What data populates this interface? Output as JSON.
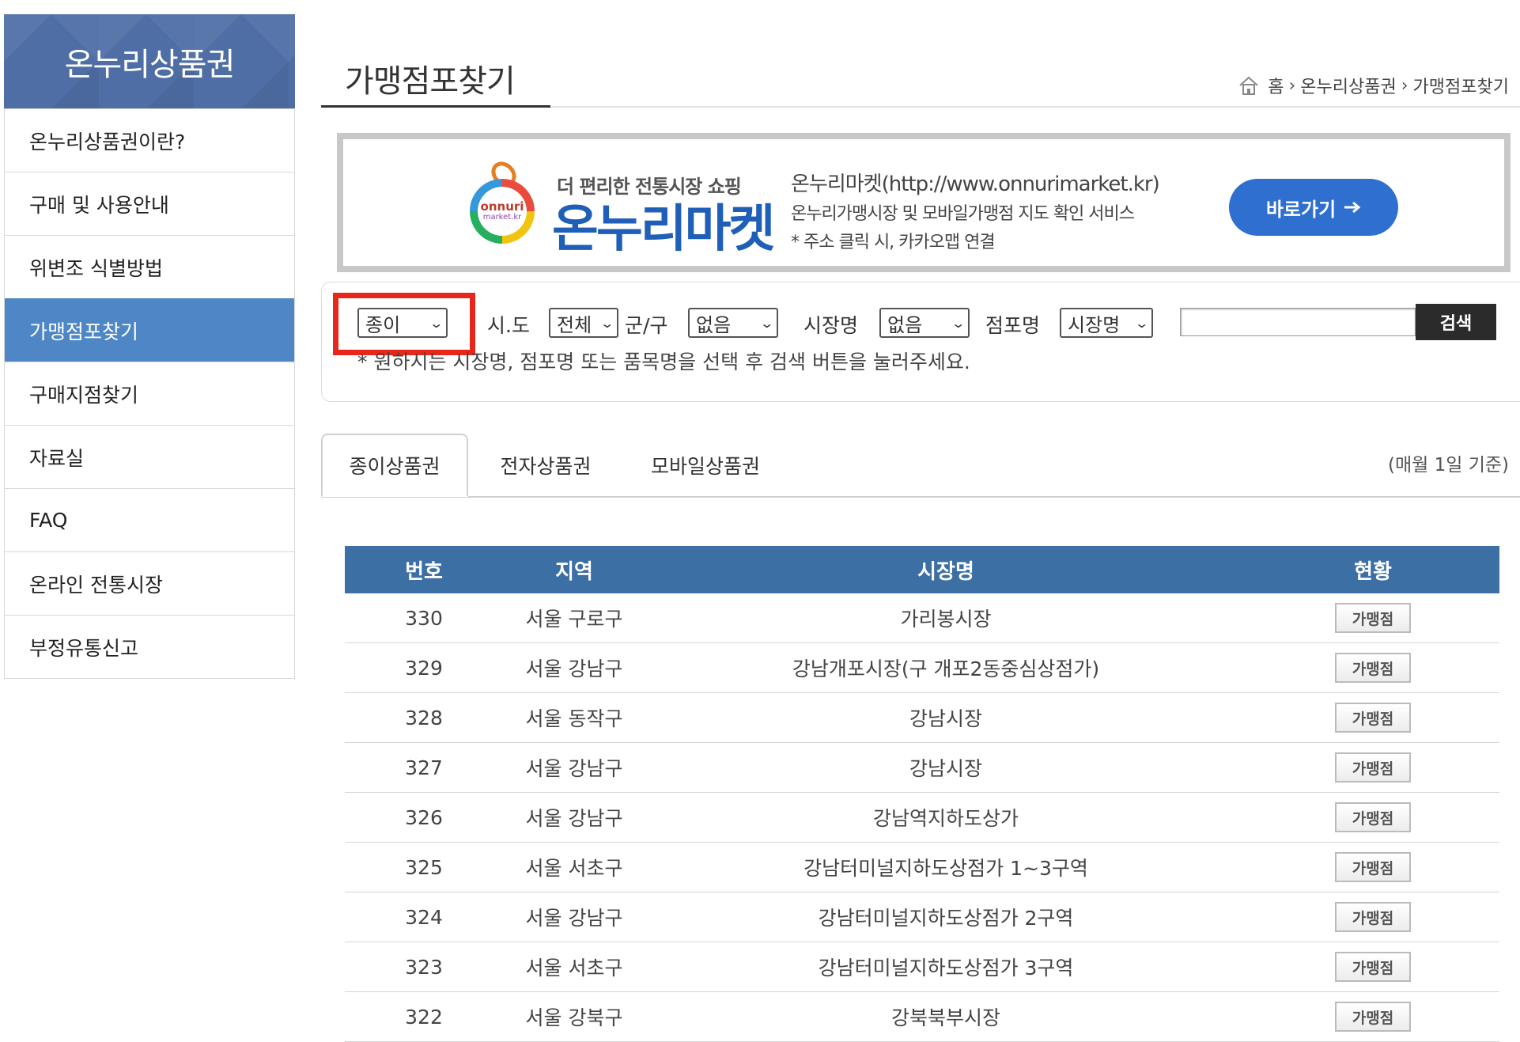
{
  "sidebar": {
    "title": "온누리상품권",
    "items": [
      {
        "label": "온누리상품권이란?"
      },
      {
        "label": "구매 및 사용안내"
      },
      {
        "label": "위변조 식별방법"
      },
      {
        "label": "가맹점포찾기"
      },
      {
        "label": "구매지점찾기"
      },
      {
        "label": "자료실"
      },
      {
        "label": "FAQ"
      },
      {
        "label": "온라인 전통시장"
      },
      {
        "label": "부정유통신고"
      }
    ],
    "active_index": 3
  },
  "header": {
    "page_title": "가맹점포찾기",
    "breadcrumb": [
      "홈",
      "온누리상품권",
      "가맹점포찾기"
    ]
  },
  "banner": {
    "tagline": "더 편리한 전통시장 쇼핑",
    "brand": "온누리마켓",
    "logo_text_1": "onnuri",
    "logo_text_2": "market.kr",
    "info_line_1": "온누리마켓(http://www.onnurimarket.kr)",
    "info_line_2": "온누리가맹시장 및 모바일가맹점 지도 확인 서비스",
    "info_line_3": "* 주소 클릭 시, 카카오맵 연결",
    "button_label": "바로가기"
  },
  "search": {
    "type_select": "종이",
    "sido_label": "시.도",
    "sido_select": "전체",
    "gungu_label": "군/구",
    "gungu_select": "없음",
    "market_label": "시장명",
    "market_select": "없음",
    "store_label": "점포명",
    "store_select": "시장명",
    "input_value": "",
    "button_label": "검색",
    "help_text": "* 원하시는 시장명, 점포명 또는 품목명을 선택 후 검색 버튼을 눌러주세요."
  },
  "tabs": [
    {
      "label": "종이상품권",
      "active": true
    },
    {
      "label": "전자상품권",
      "active": false
    },
    {
      "label": "모바일상품권",
      "active": false
    }
  ],
  "tab_note": "(매월 1일 기준)",
  "table": {
    "columns": [
      "번호",
      "지역",
      "시장명",
      "현황"
    ],
    "rows": [
      {
        "no": "330",
        "region": "서울 구로구",
        "market": "가리봉시장",
        "status": "가맹점"
      },
      {
        "no": "329",
        "region": "서울 강남구",
        "market": "강남개포시장(구 개포2동중심상점가)",
        "status": "가맹점"
      },
      {
        "no": "328",
        "region": "서울 동작구",
        "market": "강남시장",
        "status": "가맹점"
      },
      {
        "no": "327",
        "region": "서울 강남구",
        "market": "강남시장",
        "status": "가맹점"
      },
      {
        "no": "326",
        "region": "서울 강남구",
        "market": "강남역지하도상가",
        "status": "가맹점"
      },
      {
        "no": "325",
        "region": "서울 서초구",
        "market": "강남터미널지하도상점가 1~3구역",
        "status": "가맹점"
      },
      {
        "no": "324",
        "region": "서울 강남구",
        "market": "강남터미널지하도상점가 2구역",
        "status": "가맹점"
      },
      {
        "no": "323",
        "region": "서울 서초구",
        "market": "강남터미널지하도상점가 3구역",
        "status": "가맹점"
      },
      {
        "no": "322",
        "region": "서울 강북구",
        "market": "강북북부시장",
        "status": "가맹점"
      }
    ]
  },
  "colors": {
    "sidebar_header": "#4f6ea5",
    "sidebar_active": "#4f86c6",
    "table_header": "#3c6fa3",
    "highlight": "#e8271b",
    "banner_button": "#2f6fd0"
  }
}
